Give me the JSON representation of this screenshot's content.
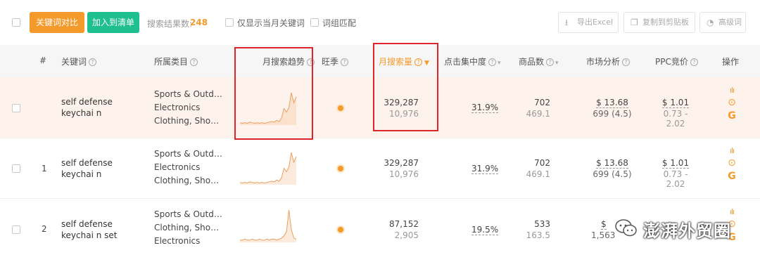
{
  "toolbar": {
    "compare_btn": "关键词对比",
    "add_list_btn": "加入到清单",
    "result_label": "搜索结果数:",
    "result_count": "248",
    "only_month_label": "仅显示当月关键词",
    "group_match_label": "词组匹配",
    "export_excel": "导出Excel",
    "copy_clipboard": "复制到剪贴板",
    "advanced": "高级词"
  },
  "header": {
    "index": "#",
    "keyword": "关键词",
    "category": "所属类目",
    "trend": "月搜索趋势",
    "season": "旺季",
    "monthly_search": "月搜索量",
    "click_concentration": "点击集中度",
    "products": "商品数",
    "market": "市场分析",
    "ppc": "PPC竞价",
    "actions": "操作"
  },
  "rows": [
    {
      "index": "",
      "keyword": "self defense keychai n",
      "categories": [
        "Sports & Outd…",
        "Electronics",
        "Clothing, Sho…"
      ],
      "search": "329,287",
      "search_sub": "10,976",
      "click": "31.9%",
      "products": "702",
      "products_sub": "469.1",
      "market": "$ 13.68",
      "market_sub": "699 (4.5)",
      "ppc": "$ 1.01",
      "ppc_sub": "0.73 - 2.02",
      "trend": [
        4,
        3,
        4,
        3,
        5,
        4,
        3,
        4,
        3,
        4,
        3,
        4,
        5,
        6,
        5,
        8,
        6,
        12,
        28,
        22,
        30,
        55,
        38,
        48
      ]
    },
    {
      "index": "1",
      "keyword": "self defense keychai n",
      "categories": [
        "Sports & Outd…",
        "Electronics",
        "Clothing, Sho…"
      ],
      "search": "329,287",
      "search_sub": "10,976",
      "click": "31.9%",
      "products": "702",
      "products_sub": "469.1",
      "market": "$ 13.68",
      "market_sub": "699 (4.5)",
      "ppc": "$ 1.01",
      "ppc_sub": "0.73 - 2.02",
      "trend": [
        4,
        3,
        4,
        3,
        5,
        4,
        3,
        4,
        3,
        4,
        3,
        4,
        5,
        6,
        5,
        8,
        6,
        12,
        28,
        22,
        30,
        55,
        38,
        48
      ]
    },
    {
      "index": "2",
      "keyword": "self defense keychai n set",
      "categories": [
        "Sports & Outd…",
        "Clothing, Sho…",
        "Electronics"
      ],
      "search": "87,152",
      "search_sub": "2,905",
      "click": "19.5%",
      "products": "533",
      "products_sub": "163.5",
      "market": "$",
      "market_sub": "1,563",
      "ppc": "",
      "ppc_sub": "",
      "trend": [
        2,
        2,
        3,
        2,
        2,
        3,
        2,
        2,
        3,
        2,
        2,
        3,
        2,
        3,
        3,
        2,
        3,
        4,
        6,
        10,
        30,
        12,
        4,
        3
      ]
    }
  ],
  "watermark": "澎湃外贸圈",
  "colors": {
    "accent": "#f39a2b",
    "green": "#1fbf8f",
    "highlight_row": "#fdf2ec",
    "red_box": "#e0242a"
  }
}
